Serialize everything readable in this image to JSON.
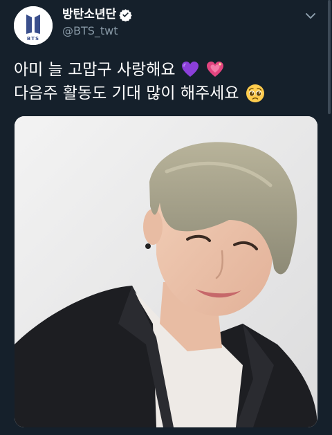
{
  "account": {
    "avatar_text": "BTS",
    "display_name": "방탄소년단",
    "handle": "@BTS_twt"
  },
  "tweet": {
    "line1": "아미 늘 고맙구 사랑해요",
    "line2": "다음주 활동도 기대 많이 해주세요",
    "emojis": [
      "purple-heart",
      "sparkling-heart",
      "pleading-face"
    ]
  },
  "colors": {
    "background": "#15202b",
    "text": "#ffffff",
    "secondary_text": "#8899a6",
    "verified": "#1da1f2",
    "logo": "#3a4f8c"
  }
}
